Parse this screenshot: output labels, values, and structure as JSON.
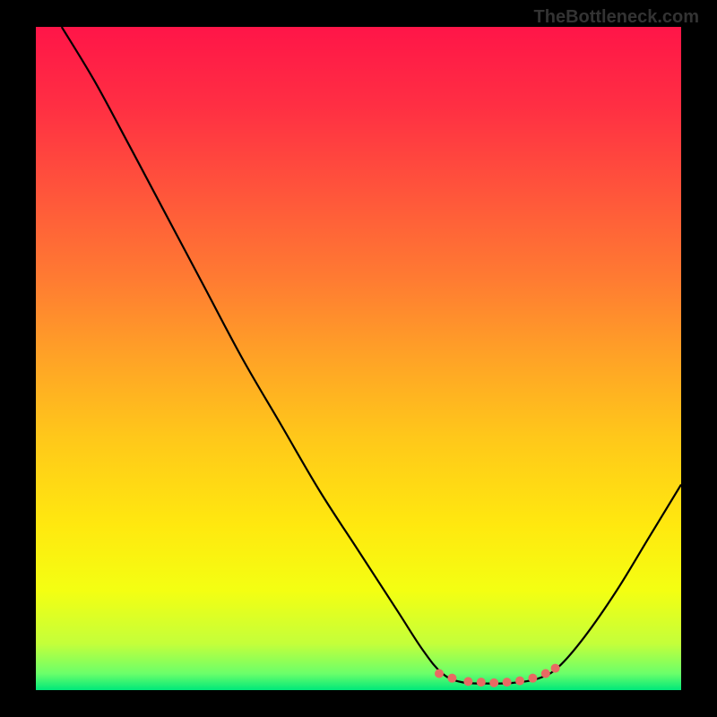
{
  "watermark": "TheBottleneck.com",
  "chart_data": {
    "type": "line",
    "title": "",
    "xlabel": "",
    "ylabel": "",
    "xlim": [
      0,
      100
    ],
    "ylim": [
      0,
      100
    ],
    "curve": {
      "name": "bottleneck-curve",
      "points": [
        {
          "x": 4,
          "y": 100
        },
        {
          "x": 9,
          "y": 92
        },
        {
          "x": 14,
          "y": 83
        },
        {
          "x": 20,
          "y": 72
        },
        {
          "x": 26,
          "y": 61
        },
        {
          "x": 32,
          "y": 50
        },
        {
          "x": 38,
          "y": 40
        },
        {
          "x": 44,
          "y": 30
        },
        {
          "x": 50,
          "y": 21
        },
        {
          "x": 56,
          "y": 12
        },
        {
          "x": 60,
          "y": 6
        },
        {
          "x": 63,
          "y": 2.5
        },
        {
          "x": 66,
          "y": 1.2
        },
        {
          "x": 70,
          "y": 1.0
        },
        {
          "x": 74,
          "y": 1.1
        },
        {
          "x": 78,
          "y": 1.8
        },
        {
          "x": 81,
          "y": 3.5
        },
        {
          "x": 85,
          "y": 8
        },
        {
          "x": 90,
          "y": 15
        },
        {
          "x": 95,
          "y": 23
        },
        {
          "x": 100,
          "y": 31
        }
      ]
    },
    "flat_zone_dots": [
      {
        "x": 62.5,
        "y": 2.5
      },
      {
        "x": 64.5,
        "y": 1.8
      },
      {
        "x": 67,
        "y": 1.3
      },
      {
        "x": 69,
        "y": 1.2
      },
      {
        "x": 71,
        "y": 1.1
      },
      {
        "x": 73,
        "y": 1.2
      },
      {
        "x": 75,
        "y": 1.4
      },
      {
        "x": 77,
        "y": 1.8
      },
      {
        "x": 79,
        "y": 2.5
      },
      {
        "x": 80.5,
        "y": 3.3
      }
    ],
    "gradient_stops": [
      {
        "offset": 0.0,
        "color": "#ff1548"
      },
      {
        "offset": 0.12,
        "color": "#ff2f43"
      },
      {
        "offset": 0.25,
        "color": "#ff553b"
      },
      {
        "offset": 0.38,
        "color": "#ff7b32"
      },
      {
        "offset": 0.5,
        "color": "#ffa326"
      },
      {
        "offset": 0.62,
        "color": "#ffc81a"
      },
      {
        "offset": 0.75,
        "color": "#ffe80f"
      },
      {
        "offset": 0.85,
        "color": "#f4ff12"
      },
      {
        "offset": 0.93,
        "color": "#c4ff3a"
      },
      {
        "offset": 0.975,
        "color": "#6bff6a"
      },
      {
        "offset": 1.0,
        "color": "#00e87a"
      }
    ],
    "dot_color": "#e86a63",
    "curve_color": "#000000"
  }
}
